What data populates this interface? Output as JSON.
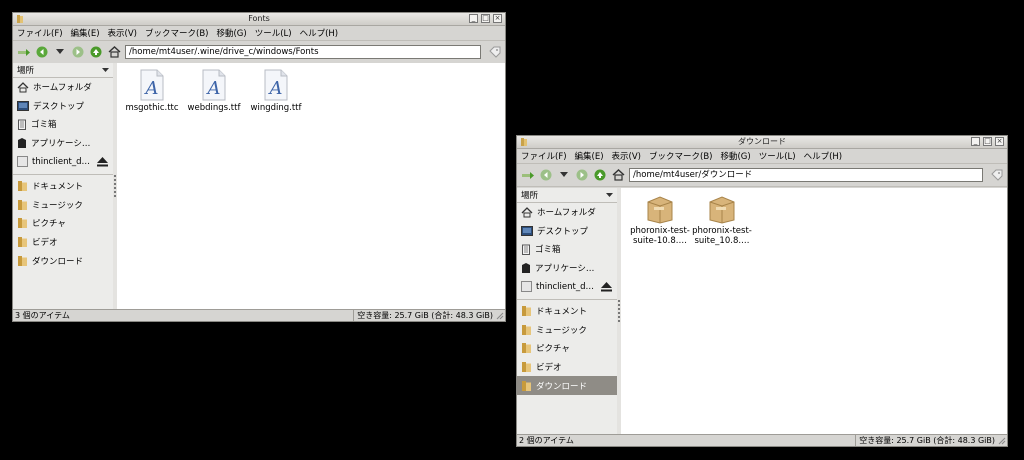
{
  "win1": {
    "title": "Fonts",
    "menu": [
      "ファイル(F)",
      "編集(E)",
      "表示(V)",
      "ブックマーク(B)",
      "移動(G)",
      "ツール(L)",
      "ヘルプ(H)"
    ],
    "path": "/home/mt4user/.wine/drive_c/windows/Fonts",
    "places_label": "場所",
    "places": [
      {
        "label": "ホームフォルダ",
        "icon": "home-icon"
      },
      {
        "label": "デスクトップ",
        "icon": "desktop-icon"
      },
      {
        "label": "ゴミ箱",
        "icon": "trash-icon"
      },
      {
        "label": "アプリケーシ…",
        "icon": "applications-icon"
      },
      {
        "label": "thinclient_d…",
        "icon": "drive-icon"
      }
    ],
    "bookmarks": [
      {
        "label": "ドキュメント",
        "icon": "folder-icon"
      },
      {
        "label": "ミュージック",
        "icon": "folder-icon"
      },
      {
        "label": "ピクチャ",
        "icon": "folder-icon"
      },
      {
        "label": "ビデオ",
        "icon": "folder-icon"
      },
      {
        "label": "ダウンロード",
        "icon": "folder-icon"
      }
    ],
    "files": [
      {
        "name": "msgothic.ttc",
        "icon": "font-file-icon"
      },
      {
        "name": "webdings.ttf",
        "icon": "font-file-icon"
      },
      {
        "name": "wingding.ttf",
        "icon": "font-file-icon"
      }
    ],
    "status_left": "3 個のアイテム",
    "status_right": "空き容量: 25.7 GiB (合計: 48.3 GiB)"
  },
  "win2": {
    "title": "ダウンロード",
    "menu": [
      "ファイル(F)",
      "編集(E)",
      "表示(V)",
      "ブックマーク(B)",
      "移動(G)",
      "ツール(L)",
      "ヘルプ(H)"
    ],
    "path": "/home/mt4user/ダウンロード",
    "places_label": "場所",
    "places": [
      {
        "label": "ホームフォルダ",
        "icon": "home-icon"
      },
      {
        "label": "デスクトップ",
        "icon": "desktop-icon"
      },
      {
        "label": "ゴミ箱",
        "icon": "trash-icon"
      },
      {
        "label": "アプリケーシ…",
        "icon": "applications-icon"
      },
      {
        "label": "thinclient_d…",
        "icon": "drive-icon"
      }
    ],
    "bookmarks": [
      {
        "label": "ドキュメント",
        "icon": "folder-icon"
      },
      {
        "label": "ミュージック",
        "icon": "folder-icon"
      },
      {
        "label": "ピクチャ",
        "icon": "folder-icon"
      },
      {
        "label": "ビデオ",
        "icon": "folder-icon"
      },
      {
        "label": "ダウンロード",
        "icon": "folder-icon",
        "selected": true
      }
    ],
    "files": [
      {
        "name": "phoronix-test-suite-10.8.…",
        "icon": "package-icon"
      },
      {
        "name": "phoronix-test-suite_10.8.…",
        "icon": "package-icon"
      }
    ],
    "status_left": "2 個のアイテム",
    "status_right": "空き容量: 25.7 GiB (合計: 48.3 GiB)"
  },
  "colors": {
    "window_bg": "#d6d5d2",
    "selection": "#8f8c86",
    "go_green": "#4a9a2a"
  }
}
